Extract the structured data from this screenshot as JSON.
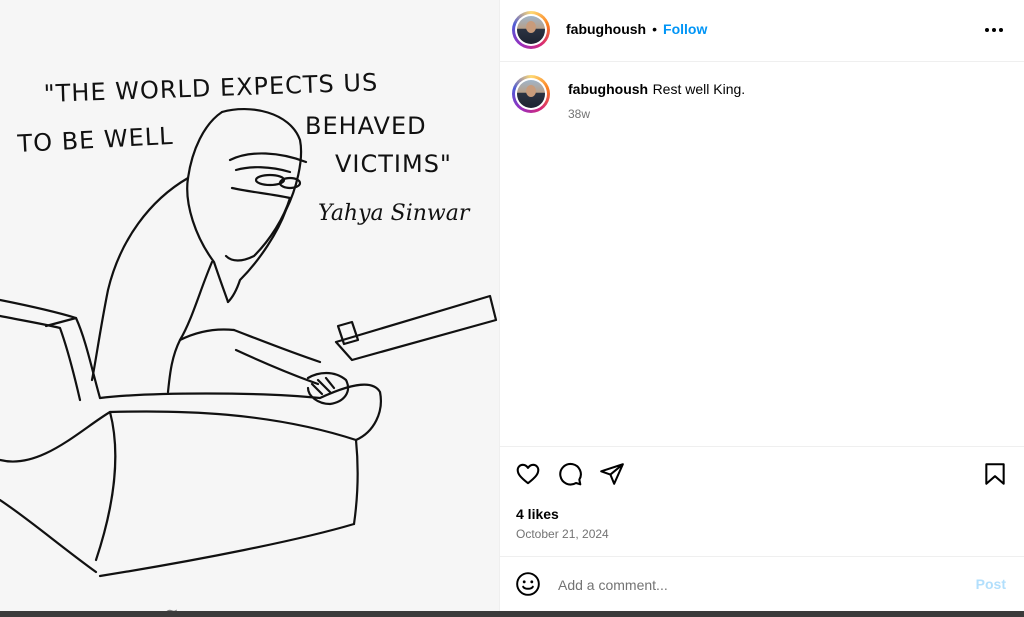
{
  "post": {
    "image": {
      "quote_line1": "\"THE WORLD EXPECTS US",
      "quote_line2": "TO BE WELL",
      "quote_line3": "BEHAVED",
      "quote_line4": "VICTIMS\"",
      "attribution": "Yahya Sinwar"
    },
    "header": {
      "username": "fabughoush",
      "separator": "•",
      "follow_label": "Follow",
      "more_icon": "more-horizontal-icon"
    },
    "caption": {
      "username": "fabughoush",
      "text": "Rest well King.",
      "time_ago": "38w"
    },
    "actions": {
      "like_icon": "heart-icon",
      "comment_icon": "comment-icon",
      "share_icon": "send-icon",
      "save_icon": "bookmark-icon"
    },
    "likes_label": "4 likes",
    "date_label": "October 21, 2024",
    "comment_box": {
      "placeholder": "Add a comment...",
      "emoji_icon": "emoji-icon",
      "post_label": "Post"
    }
  },
  "colors": {
    "link_blue": "#0095f6",
    "post_disabled": "#b2dffc",
    "meta_gray": "#737373"
  }
}
